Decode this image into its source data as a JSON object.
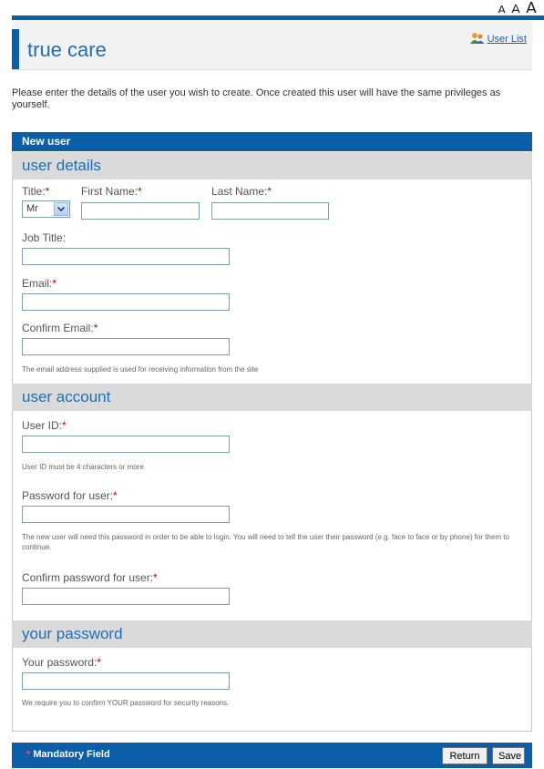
{
  "font_size_controls": [
    "A",
    "A",
    "A"
  ],
  "header": {
    "brand": "true care",
    "user_list_link": "User List",
    "user_list_icon": "users-icon"
  },
  "intro_text": "Please enter the details of the user you wish to create. Once created this user will have the same privileges as yourself.",
  "panel_title": "New user",
  "required_marker": "*",
  "colors": {
    "accent": "#0d5ea8",
    "section_bg": "#dadada",
    "required": "#cc0000",
    "heading_text": "#1f6fb4"
  },
  "sections": {
    "user_details": {
      "title": "user details",
      "title_label": "Title:",
      "title_value": "Mr",
      "first_name_label": "First Name:",
      "last_name_label": "Last Name:",
      "job_title_label": "Job Title:",
      "email_label": "Email:",
      "confirm_email_label": "Confirm Email:",
      "email_hint": "The email address supplied is used for receiving information from the site"
    },
    "user_account": {
      "title": "user account",
      "user_id_label": "User ID:",
      "user_id_hint": "User ID must be 4 characters or more",
      "password_label": "Password for user:",
      "password_hint": "The new user will need this password in order to be able to login. You will need to tell the user their password (e.g. face to face or by phone) for them to continue.",
      "confirm_password_label": "Confirm password for user:"
    },
    "your_password": {
      "title": "your password",
      "your_password_label": "Your password:",
      "your_password_hint": "We require you to confirm YOUR password for security reasons."
    }
  },
  "footer": {
    "mandatory_text": "Mandatory Field",
    "return_label": "Return",
    "save_label": "Save"
  }
}
